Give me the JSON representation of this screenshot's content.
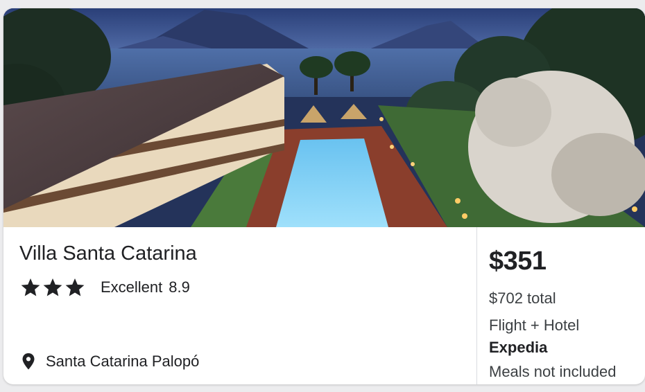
{
  "hotel": {
    "name": "Villa Santa Catarina",
    "star_count": 3,
    "rating_label": "Excellent",
    "rating_score": "8.9",
    "location": "Santa Catarina Palopó",
    "photo_icon": "hotel-photo"
  },
  "pricing": {
    "nightly_price": "$351",
    "total_price": "$702 total",
    "package_type": "Flight + Hotel",
    "provider": "Expedia",
    "meals_note": "Meals not included"
  },
  "icons": {
    "star": "star-icon",
    "location": "location-pin-icon"
  },
  "colors": {
    "text_primary": "#202124",
    "text_secondary": "#3c4043",
    "divider": "#dadce0",
    "card_background": "#ffffff"
  }
}
